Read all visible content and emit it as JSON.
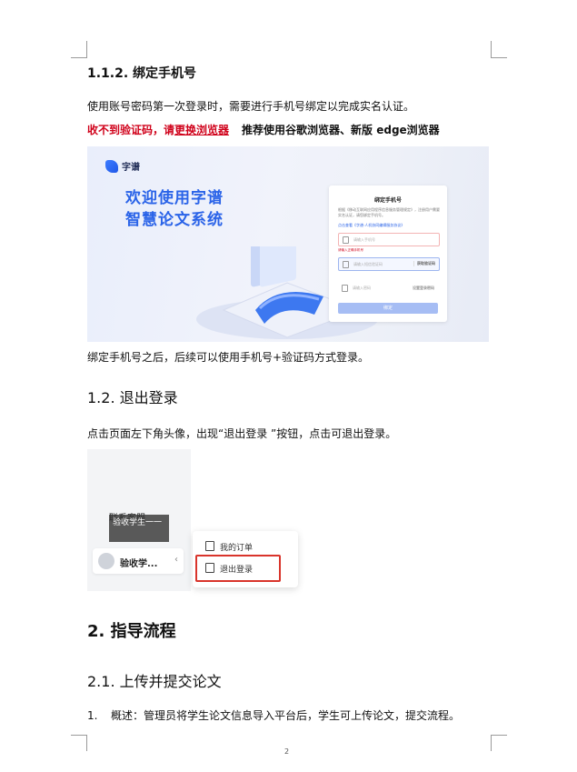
{
  "section_1_1_2": {
    "heading": "1.1.2. 绑定手机号",
    "intro": "使用账号密码第一次登录时，需要进行手机号绑定以完成实名认证。",
    "warn_red": "收不到验证码，请",
    "warn_link": "更换浏览器",
    "warn_rec": "推荐使用谷歌浏览器、新版 edge浏览器",
    "after": "绑定手机号之后，后续可以使用手机号+验证码方式登录。"
  },
  "banner": {
    "logo": "字谱",
    "line1": "欢迎使用字谱",
    "line2": "智慧论文系统",
    "card_title": "绑定手机号",
    "card_desc": "根据《移动互联网应用程序信息服务管理规定》，注册用户需要实名认证，请您绑定手机号。",
    "card_link": "点击查看《字谱·人机协同编辑服务协议》",
    "phone_placeholder": "请输入手机号",
    "phone_error": "请输入正确手机号",
    "code_placeholder": "请输入短信验证码",
    "get_code": "获取验证码",
    "pwd_placeholder": "请输入密码",
    "pwd_hint": "设置登录密码",
    "submit": "绑定"
  },
  "section_1_2": {
    "heading": "1.2. 退出登录",
    "text": "点击页面左下角头像，出现“退出登录 ”按钮，点击可退出登录。"
  },
  "logout_shot": {
    "contact": "联系客服",
    "tooltip": "验收学生一一",
    "user": "验收学...",
    "menu_orders": "我的订单",
    "menu_logout": "退出登录"
  },
  "section_2": {
    "heading": "2. 指导流程"
  },
  "section_2_1": {
    "heading": "2.1. 上传并提交论文",
    "item_num": "1.",
    "item_text": "概述：管理员将学生论文信息导入平台后，学生可上传论文，提交流程。"
  },
  "page_number": "2"
}
